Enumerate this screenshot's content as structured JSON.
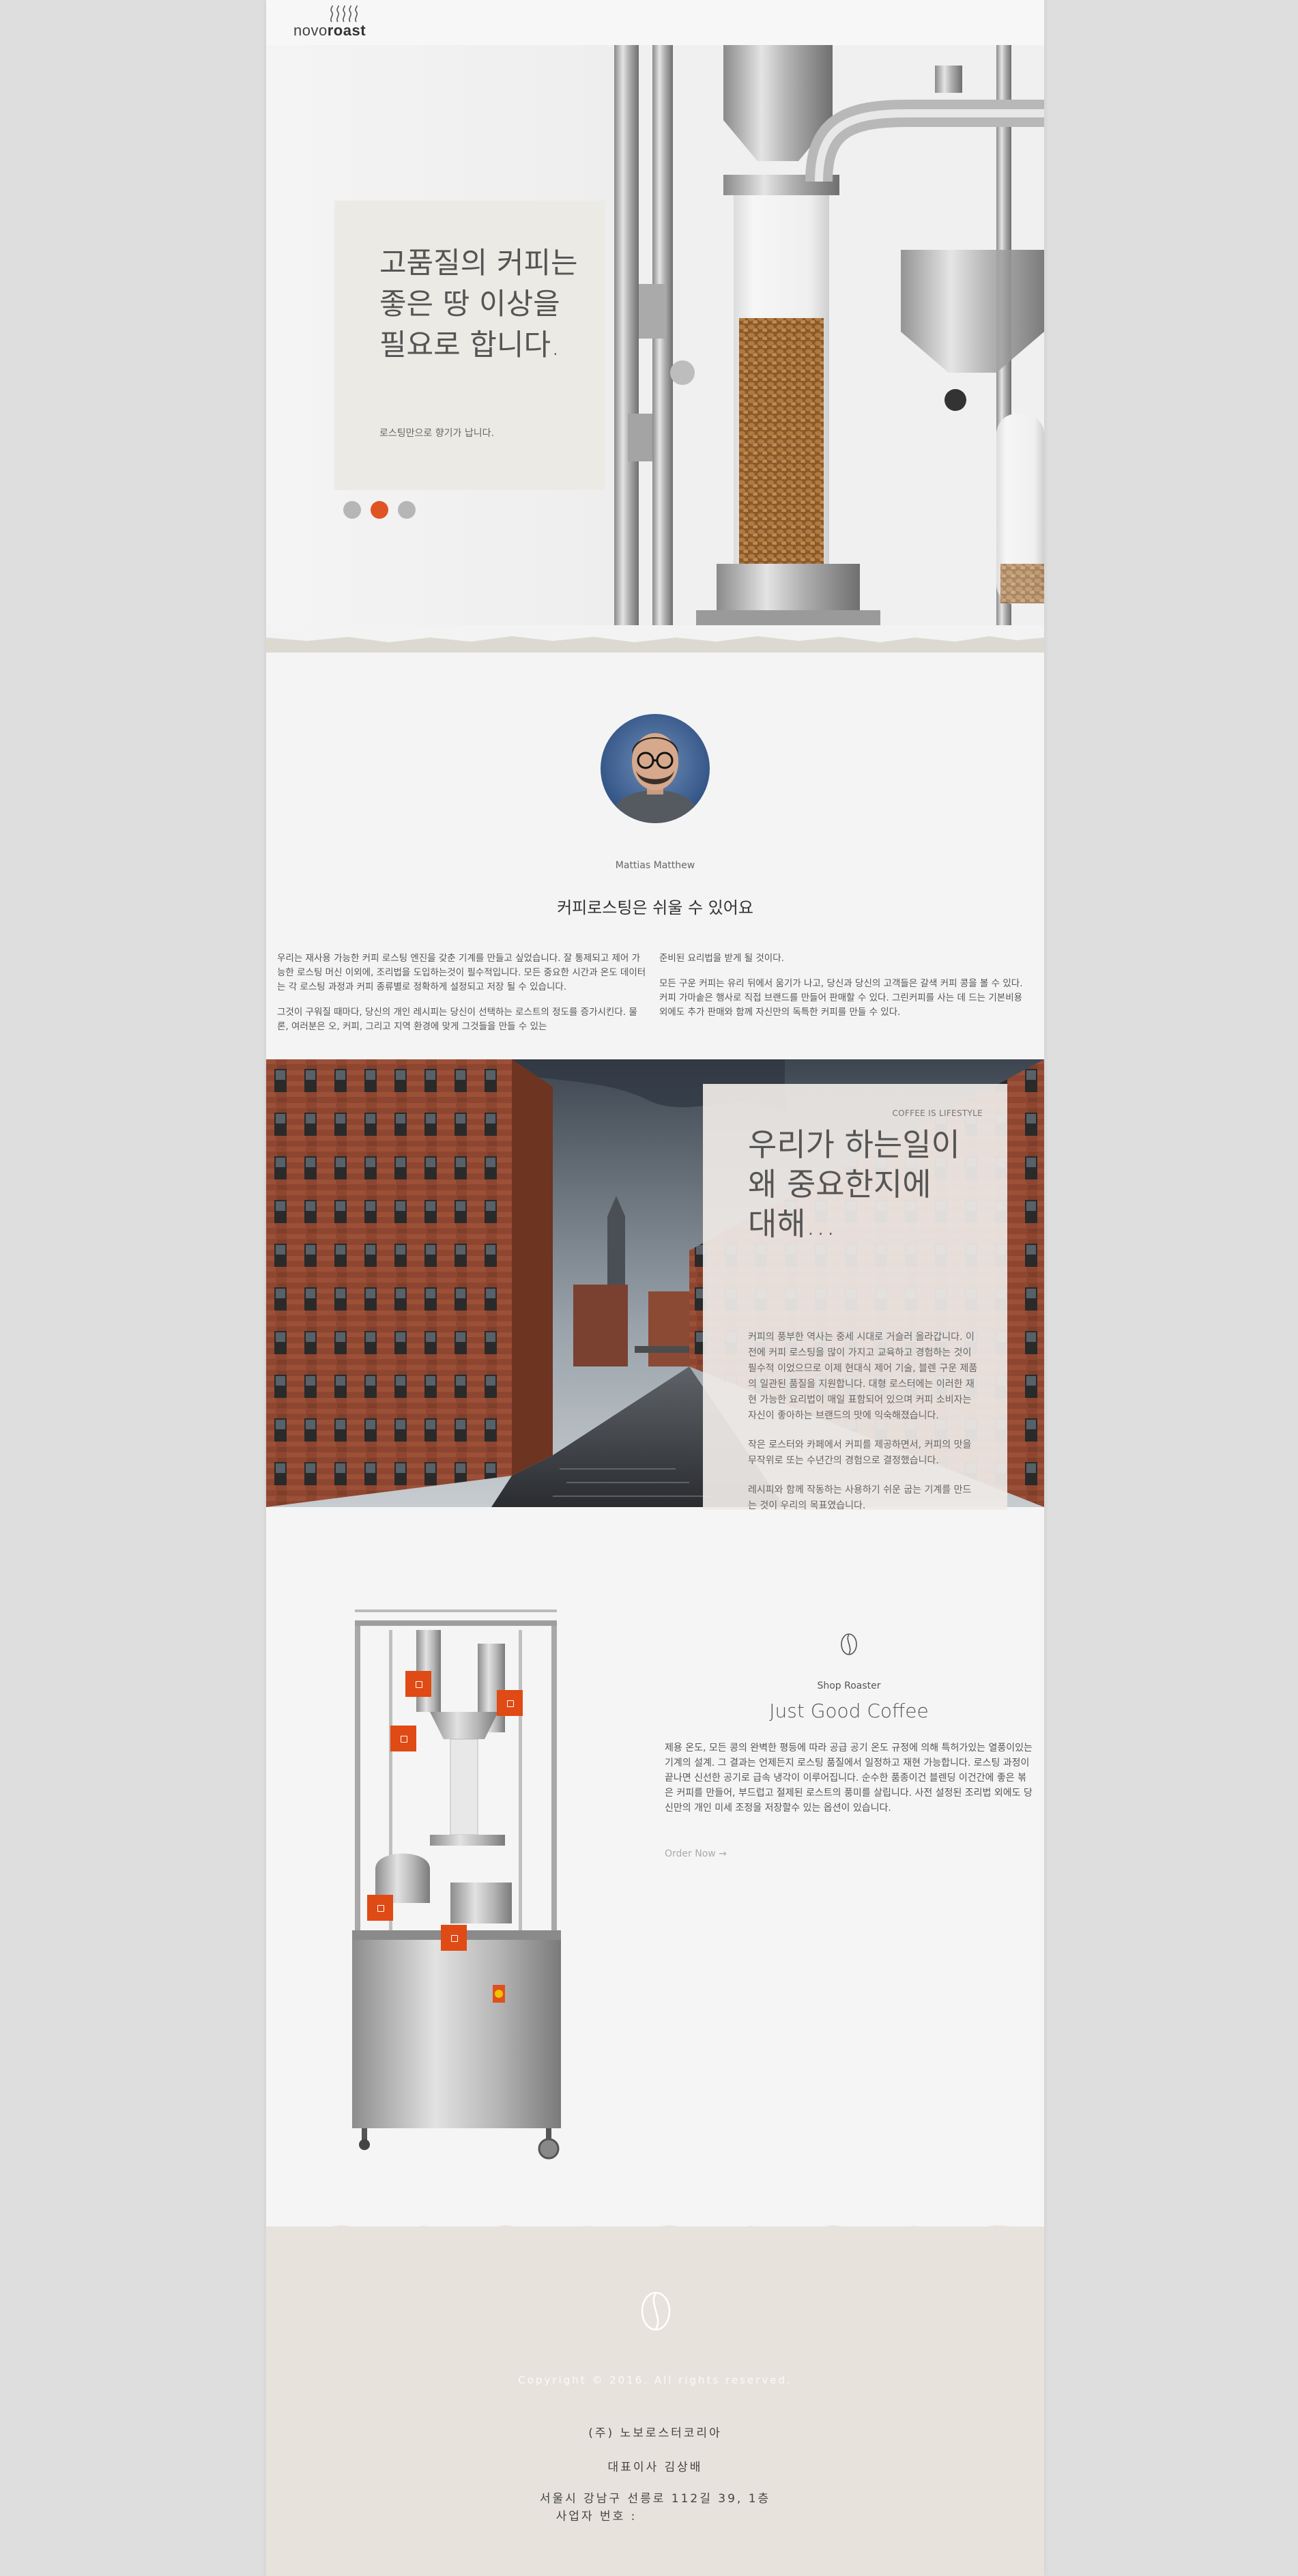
{
  "header": {
    "logo_text_light": "novo",
    "logo_text_bold": "roast"
  },
  "hero": {
    "title": "고품질의 커피는 좋은 땅 이상을 필요로 합니다.",
    "subtitle": "로스팅만으로 향기가 납니다.",
    "slides": 3,
    "active_slide": 2
  },
  "intro": {
    "author": "Mattias Matthew",
    "title": "커피로스팅은 쉬울 수 있어요",
    "left_paragraphs": [
      "우리는 재사용 가능한 커피 로스팅 엔진을 갖춘 기계를 만들고 싶었습니다. 잘 통제되고 제어 가능한 로스팅 머신 이외에, 조리법을 도입하는것이 필수적입니다. 모든 중요한 시간과 온도 데이터는 각 로스팅 과정과 커피 종류별로 정확하게 설정되고 저장 될 수 있습니다.",
      "그것이 구워질 때마다, 당신의 개인 레시피는 당신이 선택하는 로스트의 정도를 증가시킨다. 물론, 여러분은 오, 커피, 그리고 지역 환경에 맞게 그것들을 만들 수 있는"
    ],
    "right_paragraphs": [
      "준비된 요리법을 받게 될 것이다.",
      "모든 구운 커피는 유리 뒤에서 움기가 나고, 당신과 당신의 고객들은 갈색 커피 콩을 볼 수 있다. 커피 가마솥은 행사로 직접 브랜드를 만들어 판매할 수 있다. 그린커피를 사는 데 드는 기본비용 외에도 추가 판매와 함께 자신만의 독특한 커피를 만들 수 있다."
    ]
  },
  "canal": {
    "kicker": "COFFEE IS LIFESTYLE",
    "title_lines": [
      "우리가 하는일이",
      "왜 중요한지에",
      "대해..."
    ],
    "paragraphs": [
      "커피의 풍부한 역사는 중세 시대로 거슬러 올라갑니다. 이전에 커피 로스팅을 많이 가지고 교육하고 경험하는 것이 필수적 이었으므로 이제 현대식 제어 기술, 블렌 구운 제품의 일관된 품질을 지원합니다. 대형 로스터에는 이러한 재현 가능한 요리법이 매일 표함되어 있으며 커피 소비자는 자신이 좋아하는 브랜드의 맛에 익숙해졌습니다.",
      "작은 로스터와 카페에서 커피를 제공하면서, 커피의 맛을 무작위로 또는 수년간의 경험으로 결정했습니다.",
      "레시피와 함께 작동하는 사용하기 쉬운 굽는 기계를 만드는 것이 우리의 목표였습니다."
    ]
  },
  "product": {
    "kicker": "Shop Roaster",
    "title": "Just Good Coffee",
    "description": "제용 온도, 모든 콩의 완벽한 평등에 따라 공급 공기 온도 규정에 의해 특허가있는 열풍이있는 기계의 설계. 그 결과는 언제든지 로스팅 품질에서 일정하고 재현 가능합니다. 로스팅 과정이 끝나면 신선한 공기로 급속 냉각이 이루어집니다. 순수한 품종이건 블렌딩 이건간에 좋은 볶은 커피를 만들어, 부드럽고 절제된 로스트의 풍미를 살립니다. 사전 설정된 조리법 외에도 당신만의 개인 미세 조정을 저장할수 있는 옵션이 있습니다.",
    "order_link": "Order Now →"
  },
  "footer": {
    "copyright": "Copyright © 2016. All rights reserved.",
    "company": "(주) 노보로스터코리아",
    "ceo": "대표이사 김상배",
    "address": "서울시 강남구 선릉로 112길 39, 1층",
    "business_no": "사업자 번호 :"
  },
  "colors": {
    "accent": "#e05424",
    "footer_bg": "#e7e3dc",
    "card_bg": "#ece9e4"
  },
  "icons": [
    "steam-logo-icon",
    "coffee-bean-icon"
  ]
}
